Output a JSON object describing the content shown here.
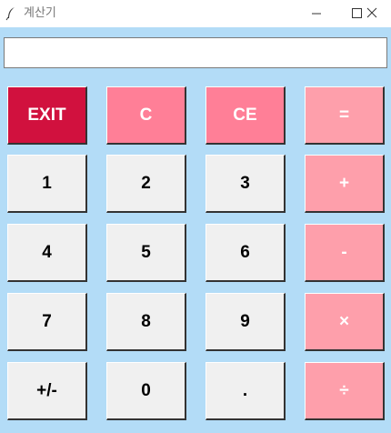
{
  "window": {
    "title": "계산기",
    "icons": {
      "app": "feather-icon",
      "minimize": "minimize-icon",
      "maximize": "maximize-icon",
      "close": "close-icon"
    }
  },
  "display": {
    "value": ""
  },
  "keys": {
    "exit": "EXIT",
    "clear": "C",
    "clear_entry": "CE",
    "equals": "=",
    "one": "1",
    "two": "2",
    "three": "3",
    "plus": "+",
    "four": "4",
    "five": "5",
    "six": "6",
    "minus": "-",
    "seven": "7",
    "eight": "8",
    "nine": "9",
    "multiply": "×",
    "negate": "+/-",
    "zero": "0",
    "decimal": ".",
    "divide": "÷"
  },
  "colors": {
    "background": "#b3dcf7",
    "number_key": "#f0f0f0",
    "exit_key": "#d1113e",
    "clear_keys": "#ff7f97",
    "operator_keys": "#fe9fab"
  }
}
